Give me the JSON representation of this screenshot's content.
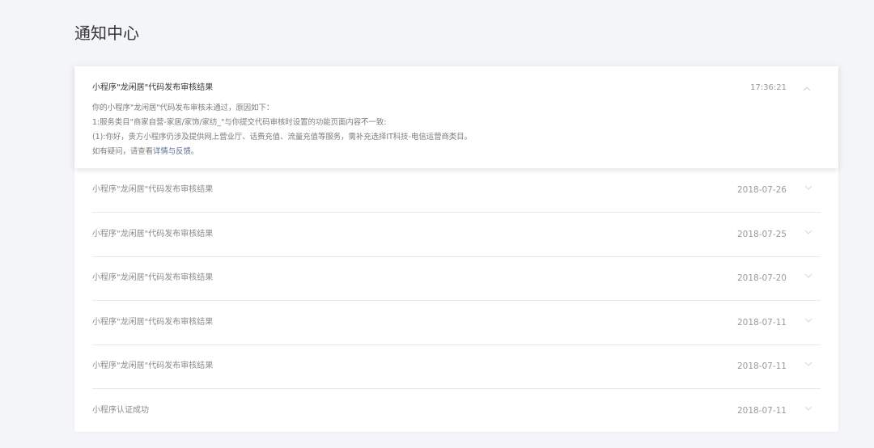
{
  "page": {
    "title": "通知中心"
  },
  "expanded": {
    "subject": "小程序\"龙闲居\"代码发布审核结果",
    "time": "17:36:21",
    "line1": "你的小程序\"龙闲居\"代码发布审核未通过，原因如下：",
    "line2": "1:服务类目\"商家自营-家居/家饰/家纺_\"与你提交代码审核时设置的功能页面内容不一致:",
    "line3": "(1):你好，贵方小程序仍涉及提供网上营业厅、话费充值、流量充值等服务，需补充选择IT科技-电信运营商类目。",
    "line4_prefix": "如有疑问，请查看",
    "line4_link": "详情与反馈",
    "line4_suffix": "。"
  },
  "items": [
    {
      "subject": "小程序\"龙闲居\"代码发布审核结果",
      "date": "2018-07-26"
    },
    {
      "subject": "小程序\"龙闲居\"代码发布审核结果",
      "date": "2018-07-25"
    },
    {
      "subject": "小程序\"龙闲居\"代码发布审核结果",
      "date": "2018-07-20"
    },
    {
      "subject": "小程序\"龙闲居\"代码发布审核结果",
      "date": "2018-07-11"
    },
    {
      "subject": "小程序\"龙闲居\"代码发布审核结果",
      "date": "2018-07-11"
    },
    {
      "subject": "小程序认证成功",
      "date": "2018-07-11"
    }
  ],
  "icons": {
    "collapse": "chevron-up-icon",
    "expand": "chevron-down-icon"
  }
}
